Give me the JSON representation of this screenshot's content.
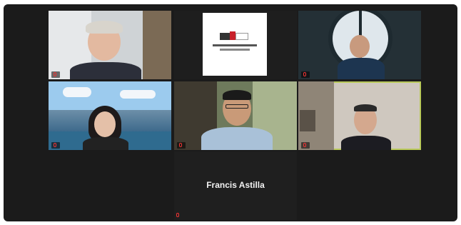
{
  "meeting": {
    "participants": [
      {
        "name": "",
        "role": "host"
      },
      {
        "name": "",
        "role": "logo"
      },
      {
        "name": "",
        "role": "participant"
      },
      {
        "name": "",
        "role": "participant"
      },
      {
        "name": "",
        "role": "participant"
      },
      {
        "name": "",
        "role": "participant",
        "active_speaker": true
      }
    ],
    "audio_only": {
      "display_name": "Francis Astilla",
      "tag": ""
    }
  },
  "colors": {
    "window_bg": "#1b1b1b",
    "active_speaker_border": "#b9c95a"
  }
}
